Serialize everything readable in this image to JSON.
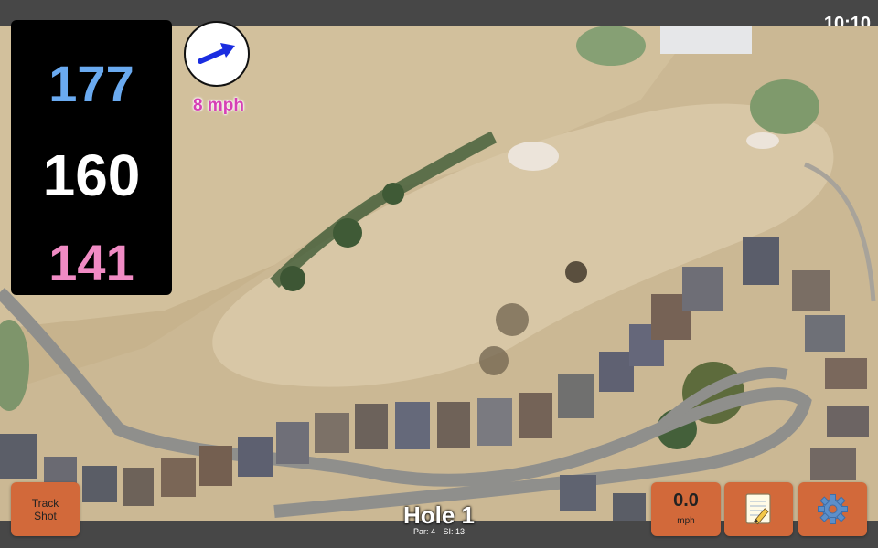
{
  "status_bar": {
    "time": "10:10"
  },
  "yardages": {
    "back": "177",
    "center": "160",
    "front": "141"
  },
  "wind": {
    "speed": "8 mph",
    "icon": "wind-arrow-icon"
  },
  "hole": {
    "title": "Hole 1",
    "par": "Par: 4",
    "stroke_index": "SI: 13"
  },
  "buttons": {
    "track_shot_line1": "Track",
    "track_shot_line2": "Shot",
    "speed_value": "0.0",
    "speed_unit": "mph",
    "notes_icon": "notepad-icon",
    "settings_icon": "gear-icon"
  },
  "colors": {
    "button": "#d2693a",
    "back_yardage": "#6aaaf0",
    "front_yardage": "#f08bc4",
    "wind_text": "#d640b5"
  }
}
